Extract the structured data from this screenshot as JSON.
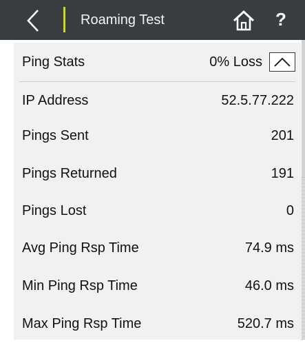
{
  "header": {
    "title": "Roaming Test",
    "help_label": "?",
    "accent_color": "#c5df13"
  },
  "section": {
    "title": "Ping Stats",
    "summary": "0% Loss"
  },
  "stats": [
    {
      "label": "IP Address",
      "value": "52.5.77.222"
    },
    {
      "label": "Pings Sent",
      "value": "201"
    },
    {
      "label": "Pings Returned",
      "value": "191"
    },
    {
      "label": "Pings Lost",
      "value": "0"
    },
    {
      "label": "Avg Ping Rsp Time",
      "value": "74.9 ms"
    },
    {
      "label": "Min Ping Rsp Time",
      "value": "46.0 ms"
    },
    {
      "label": "Max Ping Rsp Time",
      "value": "520.7 ms"
    }
  ],
  "icons": {
    "back": "chevron-left-icon",
    "home": "home-icon",
    "collapse": "chevron-up-icon"
  }
}
